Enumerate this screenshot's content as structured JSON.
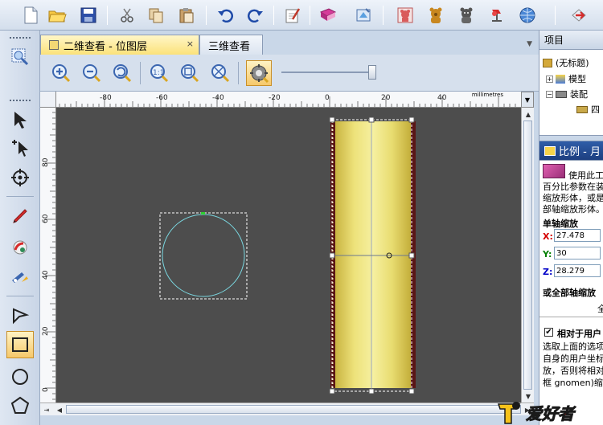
{
  "toolbar": {
    "buttons": [
      "new-file",
      "open-folder",
      "save",
      "cut",
      "copy",
      "paste",
      "undo",
      "redo",
      "edit-notes",
      "library-book",
      "settings-wizard",
      "assembly-wizard",
      "bear-icon",
      "bear-2-icon",
      "gallery",
      "render",
      "globe",
      "exit"
    ]
  },
  "tabs": [
    {
      "label": "二维查看 - 位图层",
      "close": "×"
    },
    {
      "label": "三维查看"
    }
  ],
  "ruler": {
    "units": "millimetres",
    "h_ticks": [
      "-80",
      "-60",
      "-40",
      "-20",
      "0",
      "20",
      "40"
    ],
    "v_ticks": [
      "80",
      "60",
      "40",
      "20",
      "0"
    ]
  },
  "right_panel": {
    "project_header": "项目",
    "tree": [
      {
        "label": "(无标题)"
      },
      {
        "label": "模型",
        "expander": "+"
      },
      {
        "label": "装配",
        "expander": "−"
      },
      {
        "label": "四"
      }
    ],
    "scale_header": "比例 - 月",
    "scale_desc": [
      "使用此工",
      "百分比参数在装",
      "缩放形体，或是",
      "部轴缩放形体。"
    ],
    "single_axis_label": "单轴缩放",
    "x_label": "X:",
    "x_value": "27.478",
    "y_label": "Y:",
    "y_value": "30",
    "z_label": "Z:",
    "z_value": "28.279",
    "all_axis_label": "或全部轴缩放",
    "all_axis_value": "全",
    "relative_label": "相对于用户",
    "relative_desc": [
      "选取上面的选项",
      "自身的用户坐标",
      "放，否则将相对",
      "框 gnomen)缩放"
    ]
  },
  "watermark": "爱好者",
  "colors": {
    "canvas_bg": "#4d4d4d",
    "tab_active": "#fbe27a",
    "panel_bg": "#c9d7e8",
    "x_axis_color": "#d40000",
    "y_axis_color": "#008000",
    "z_axis_color": "#0000c8"
  }
}
